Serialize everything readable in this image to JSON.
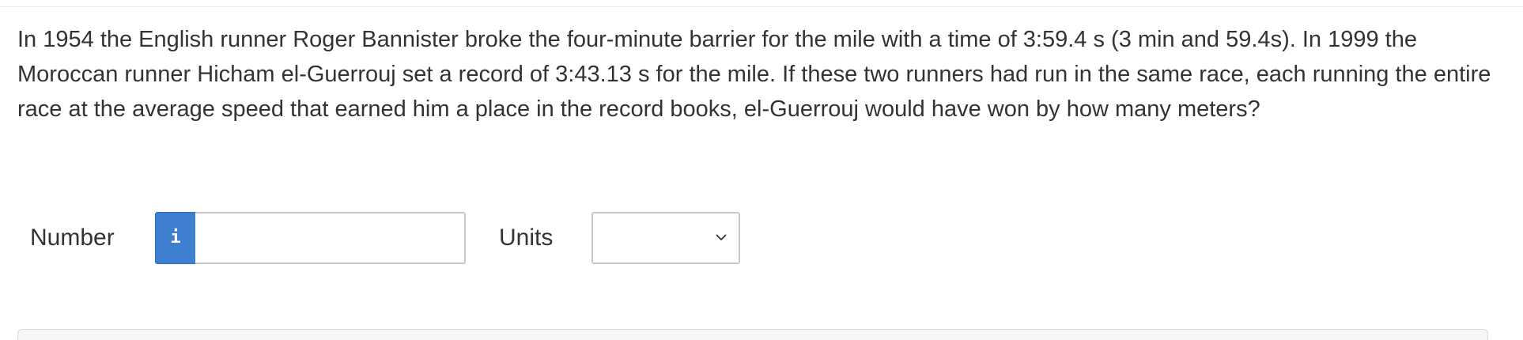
{
  "question": {
    "text": "In 1954 the English runner Roger Bannister broke the four-minute barrier for the mile with a time of 3:59.4 s (3 min and 59.4s). In 1999 the Moroccan runner Hicham el-Guerrouj set a record of 3:43.13 s for the mile. If these two runners had run in the same race, each running the entire race at the average speed that earned him a place in the record books, el-Guerrouj would have won by how many meters?"
  },
  "answer": {
    "number_label": "Number",
    "info_glyph": "i",
    "number_value": "",
    "units_label": "Units",
    "units_selected": ""
  },
  "icons": {
    "info": "info-icon",
    "dropdown": "chevron-down-icon"
  },
  "colors": {
    "info_button": "#3f7fd0",
    "text": "#333333",
    "border": "#c8c8c8"
  }
}
